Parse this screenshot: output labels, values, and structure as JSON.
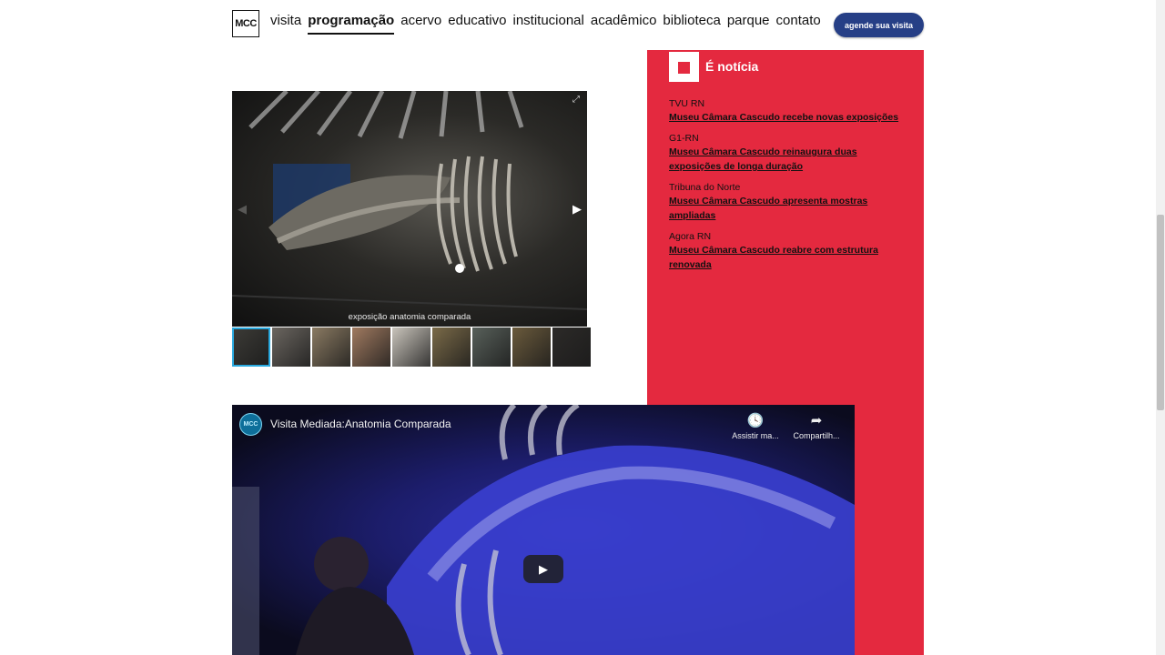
{
  "header": {
    "logo_text": "MCC",
    "nav": [
      "visita",
      "programação",
      "acervo",
      "educativo",
      "institucional",
      "acadêmico",
      "biblioteca",
      "parque",
      "contato"
    ],
    "active_nav": "programação",
    "cta_label": "agende sua visita"
  },
  "gallery": {
    "caption": "exposição anatomia comparada",
    "next_icon": "▶",
    "prev_icon": "◀",
    "expand_icon": "⤢",
    "thumb_count": 9,
    "active_thumb": 1
  },
  "news": {
    "title": "É notícia",
    "items": [
      {
        "source": "TVU RN",
        "headline": "Museu Câmara Cascudo recebe novas exposições"
      },
      {
        "source": "G1-RN",
        "headline": "Museu Câmara Cascudo reinaugura duas exposições de longa duração"
      },
      {
        "source": "Tribuna do Norte",
        "headline": "Museu Câmara Cascudo apresenta mostras ampliadas"
      },
      {
        "source": "Agora RN",
        "headline": "Museu Câmara Cascudo reabre com estrutura renovada"
      }
    ]
  },
  "video": {
    "channel_badge": "MCC",
    "title": "Visita Mediada:Anatomia Comparada",
    "watch_later": "Assistir ma...",
    "share": "Compartilh...",
    "watch_later_icon": "🕓",
    "share_icon": "➦",
    "play_icon": "▶"
  },
  "colors": {
    "accent_red": "#e4293f",
    "cta_blue": "#263f86",
    "thumb_highlight": "#29a9df"
  }
}
